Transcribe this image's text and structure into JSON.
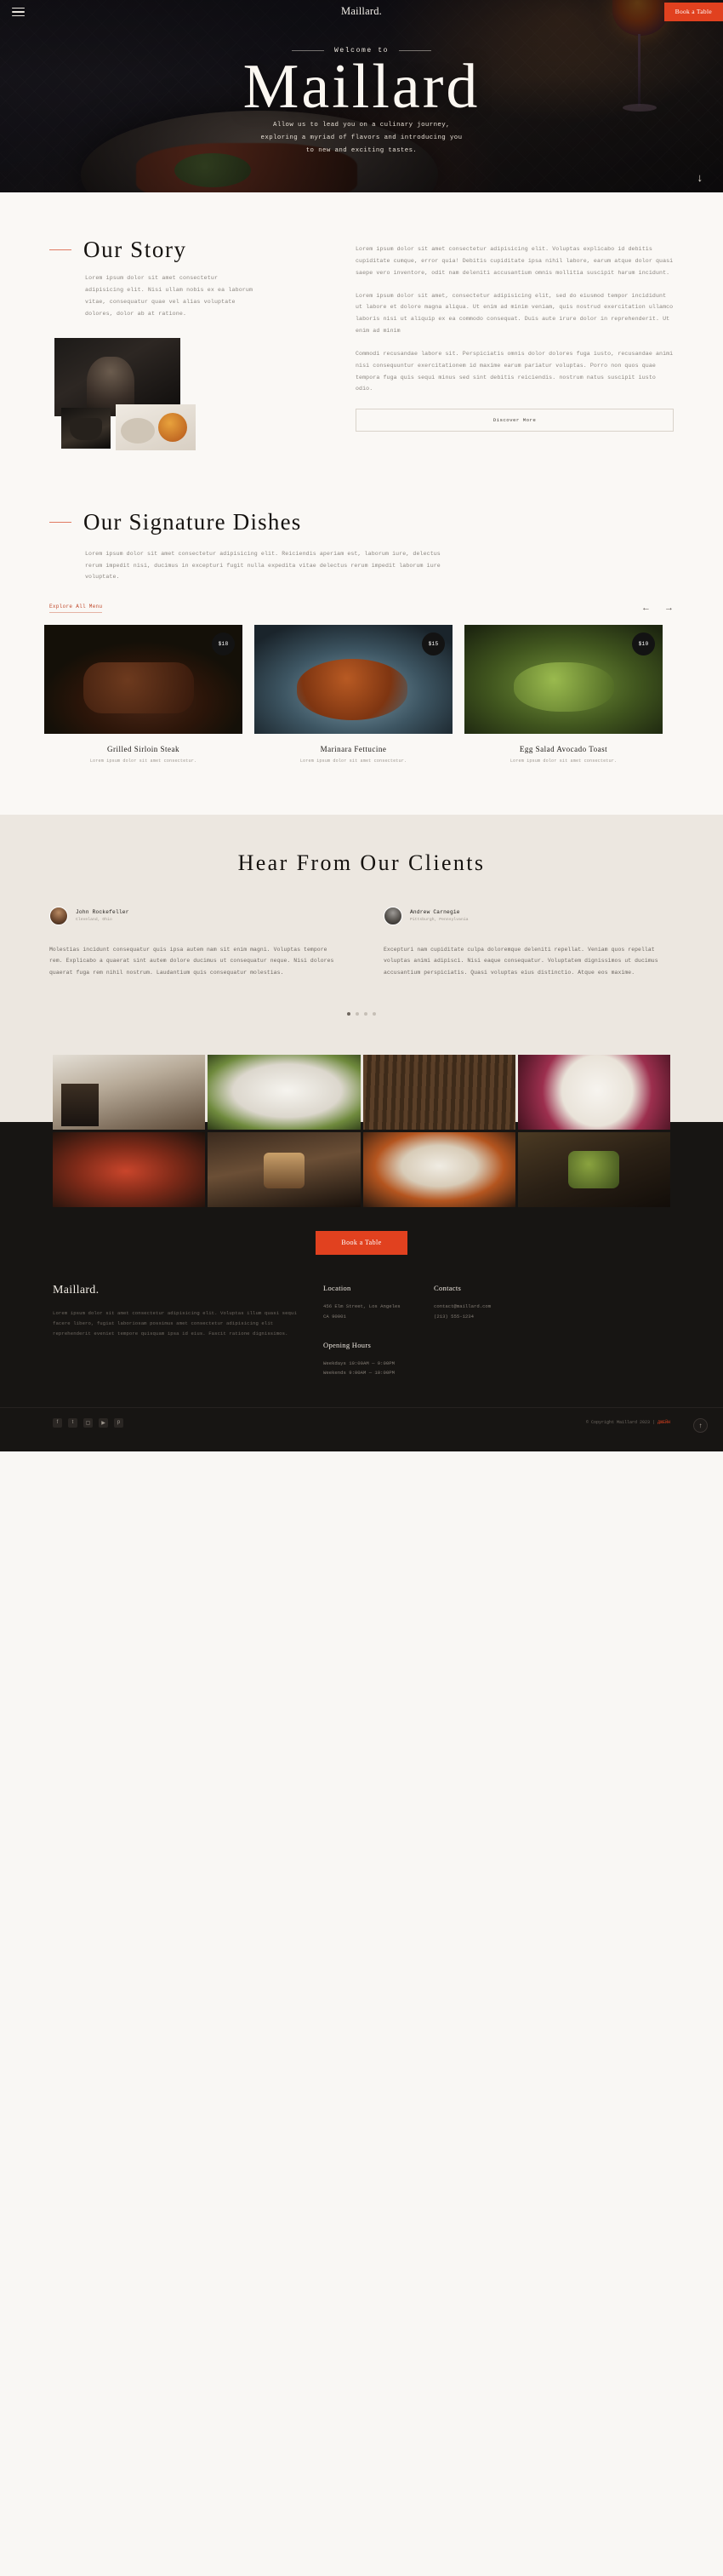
{
  "nav": {
    "menu_icon": "hamburger-menu-icon",
    "brand": "Maillard.",
    "book_label": "Book a Table"
  },
  "hero": {
    "eyebrow": "Welcome to",
    "title": "Maillard",
    "description": "Allow us to lead you on a culinary journey, exploring a myriad of flavors and introducing you to new and exciting tastes.",
    "scroll_icon": "down-arrow-icon"
  },
  "story": {
    "title": "Our Story",
    "intro": "Lorem ipsum dolor sit amet consectetur adipisicing elit. Nisi ullam nobis ex ea laborum vitae, consequatur quae vel alias voluptate dolores, dolor ab at ratione.",
    "paragraphs": [
      "Lorem ipsum dolor sit amet consectetur adipisicing elit. Voluptas explicabo id debitis cupiditate cumque, error quia! Debitis cupiditate ipsa nihil labore, earum atque dolor quasi saepe vero inventore, odit nam deleniti accusantium omnis mollitia suscipit harum incidunt.",
      "Lorem ipsum dolor sit amet, consectetur adipisicing elit, sed do eiusmod tempor incididunt ut labore et dolore magna aliqua. Ut enim ad minim veniam, quis nostrud exercitation ullamco laboris nisi ut aliquip ex ea commodo consequat. Duis aute irure dolor in reprehenderit. Ut enim ad minim",
      "Commodi recusandae labore sit. Perspiciatis omnis dolor dolores fuga iusto, recusandae animi nisi consequuntur exercitationem id maxime earum pariatur voluptas. Porro non quos quae tempora fuga quis sequi minus sed sint debitis reiciendis. nostrum natus suscipit iusto odio."
    ],
    "button": "Discover More",
    "images": [
      "chef-portrait-image",
      "dark-bowl-image",
      "plated-dish-image"
    ]
  },
  "dishes": {
    "title": "Our Signature Dishes",
    "description": "Lorem ipsum dolor sit amet consectetur adipisicing elit. Reiciendis aperiam est, laborum iure, delectus rerum impedit nisi, ducimus in excepturi fugit nulla expedita vitae delectus rerum impedit laborum iure voluptate.",
    "explore_label": "Explore All Menu",
    "prev_icon": "arrow-left-icon",
    "next_icon": "arrow-right-icon",
    "items": [
      {
        "name": "Grilled Sirloin Steak",
        "price": "$18",
        "sub": "Lorem ipsum dolor sit amet consectetur."
      },
      {
        "name": "Marinara Fettucine",
        "price": "$15",
        "sub": "Lorem ipsum dolor sit amet consectetur."
      },
      {
        "name": "Egg Salad Avocado Toast",
        "price": "$10",
        "sub": "Lorem ipsum dolor sit amet consectetur."
      }
    ]
  },
  "clients": {
    "title": "Hear From Our Clients",
    "testimonials": [
      {
        "name": "John Rockefeller",
        "location": "Cleveland, Ohio",
        "body": "Molestias incidunt consequatur quis ipsa autem nam sit enim magni. Voluptas tempore rem. Explicabo a quaerat sint autem dolore ducimus ut consequatur neque. Nisi dolores quaerat fuga rem nihil nostrum. Laudantium quis consequatur molestias."
      },
      {
        "name": "Andrew Carnegie",
        "location": "Pittsburgh, Pennsylvania",
        "body": "Excepturi nam cupiditate culpa doloremque deleniti repellat. Veniam quos repellat voluptas animi adipisci. Nisi eaque consequatur. Voluptatem dignissimos ut ducimus accusantium perspiciatis. Quasi voluptas eius distinctio. Atque eos maxime."
      }
    ],
    "dots": 4,
    "active_dot": 0
  },
  "gallery": {
    "tiles": [
      "restaurant-interior-image",
      "white-plate-salad-image",
      "wood-panel-image",
      "berry-dessert-image",
      "red-pasta-image",
      "layered-dessert-image",
      "salmon-dish-image",
      "avocado-grill-image"
    ]
  },
  "cta": {
    "label": "Book a Table"
  },
  "footer": {
    "brand": "Maillard.",
    "description": "Lorem ipsum dolor sit amet consectetur adipisicing elit. Voluptas illum quasi sequi facere libero, fugiat laboriosam possimus amet consectetur adipisicing elit reprehenderit eveniet tempore quisquam ipsa id eius. Fascit ratione dignissimos.",
    "location_heading": "Location",
    "location_lines": [
      "456 Elm Street, Los Angeles",
      "CA 90001"
    ],
    "hours_heading": "Opening Hours",
    "hours_lines": [
      "Weekdays  10:00AM — 9:00PM",
      "Weekends  9:00AM — 10:00PM"
    ],
    "contacts_heading": "Contacts",
    "contacts_lines": [
      "contact@maillard.com",
      "(213) 555-1234"
    ],
    "socials": [
      "facebook-icon",
      "twitter-icon",
      "instagram-icon",
      "youtube-icon",
      "pinterest-icon"
    ],
    "copyright_prefix": "© Copyright Maillard 2023 | ",
    "copyright_brand": "ДЖЕЙН",
    "to_top_icon": "up-arrow-icon"
  },
  "colors": {
    "accent": "#e1411f",
    "dark": "#171513",
    "cream": "#faf8f5",
    "beige": "#ece7e0"
  }
}
